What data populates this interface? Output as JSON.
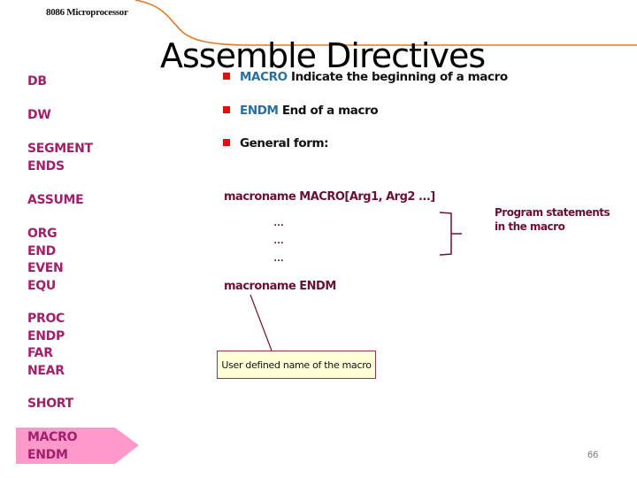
{
  "header": {
    "course_title": "8086 Microprocessor"
  },
  "slide": {
    "title": "Assemble Directives",
    "page_number": "66"
  },
  "sidebar": {
    "items": [
      {
        "lines": [
          "DB"
        ],
        "active": false
      },
      {
        "lines": [
          "DW"
        ],
        "active": false
      },
      {
        "lines": [
          "SEGMENT",
          "ENDS"
        ],
        "active": false
      },
      {
        "lines": [
          "ASSUME"
        ],
        "active": false
      },
      {
        "lines": [
          "ORG",
          "END",
          "EVEN",
          "EQU"
        ],
        "active": false
      },
      {
        "lines": [
          "PROC",
          "ENDP",
          "FAR",
          "NEAR"
        ],
        "active": false
      },
      {
        "lines": [
          "SHORT"
        ],
        "active": false
      },
      {
        "lines": [
          "MACRO",
          "ENDM"
        ],
        "active": true
      }
    ]
  },
  "bullets": [
    {
      "keyword": "MACRO",
      "text": " Indicate the beginning of a macro"
    },
    {
      "keyword": "ENDM",
      "text": " End of a macro"
    },
    {
      "keyword": "",
      "text": "General form:"
    }
  ],
  "code": {
    "start_line": "macroname MACRO[Arg1, Arg2 ...]",
    "body_lines": [
      "…",
      "…",
      "…"
    ],
    "end_line": "macroname ENDM"
  },
  "annotations": {
    "body_note": [
      "Program statements",
      "in the macro"
    ],
    "name_note": "User defined name of the macro"
  },
  "colors": {
    "accent_orange": "#e07a2a",
    "sidebar_text": "#a0206b",
    "active_highlight": "#ff99cc",
    "keyword_blue": "#2a6ea0",
    "bullet_red": "#e01010",
    "code_maroon": "#6b1035",
    "callout_fill": "#ffffd8"
  }
}
